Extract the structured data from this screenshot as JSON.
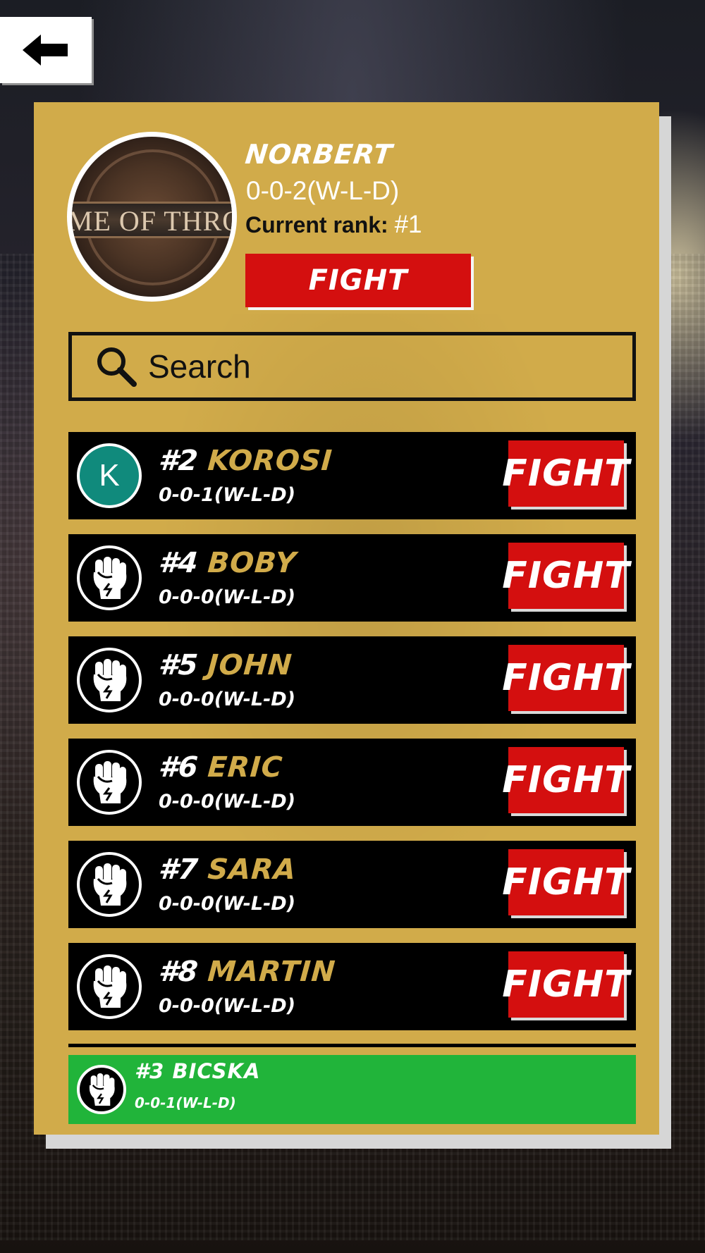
{
  "profile": {
    "avatar_alt": "Game of Thrones emblem",
    "avatar_text": "AME OF THRONE",
    "name": "NORBERT",
    "record": "0-0-2(W-L-D)",
    "rank_label": "Current rank:",
    "rank_value": "#1",
    "fight_label": "FIGHT"
  },
  "search": {
    "placeholder": "Search",
    "value": ""
  },
  "opponents": [
    {
      "rank": "#2",
      "name": "KOROSI",
      "record": "0-0-1(W-L-D)",
      "avatar": "K",
      "avatar_type": "letter",
      "fight_label": "FIGHT"
    },
    {
      "rank": "#4",
      "name": "BOBY",
      "record": "0-0-0(W-L-D)",
      "avatar_type": "fist-icon",
      "fight_label": "FIGHT"
    },
    {
      "rank": "#5",
      "name": "JOHN",
      "record": "0-0-0(W-L-D)",
      "avatar_type": "fist-icon",
      "fight_label": "FIGHT"
    },
    {
      "rank": "#6",
      "name": "ERIC",
      "record": "0-0-0(W-L-D)",
      "avatar_type": "fist-icon",
      "fight_label": "FIGHT"
    },
    {
      "rank": "#7",
      "name": "SARA",
      "record": "0-0-0(W-L-D)",
      "avatar_type": "fist-icon",
      "fight_label": "FIGHT"
    },
    {
      "rank": "#8",
      "name": "MARTIN",
      "record": "0-0-0(W-L-D)",
      "avatar_type": "fist-icon",
      "fight_label": "FIGHT"
    }
  ],
  "own_entry": {
    "rank": "#3",
    "name": "BICSKA",
    "record": "0-0-1(W-L-D)",
    "avatar_type": "fist-icon"
  },
  "colors": {
    "gold": "#d1ab4a",
    "red": "#d40f0f",
    "green": "#21b43a",
    "teal": "#108a7c"
  }
}
